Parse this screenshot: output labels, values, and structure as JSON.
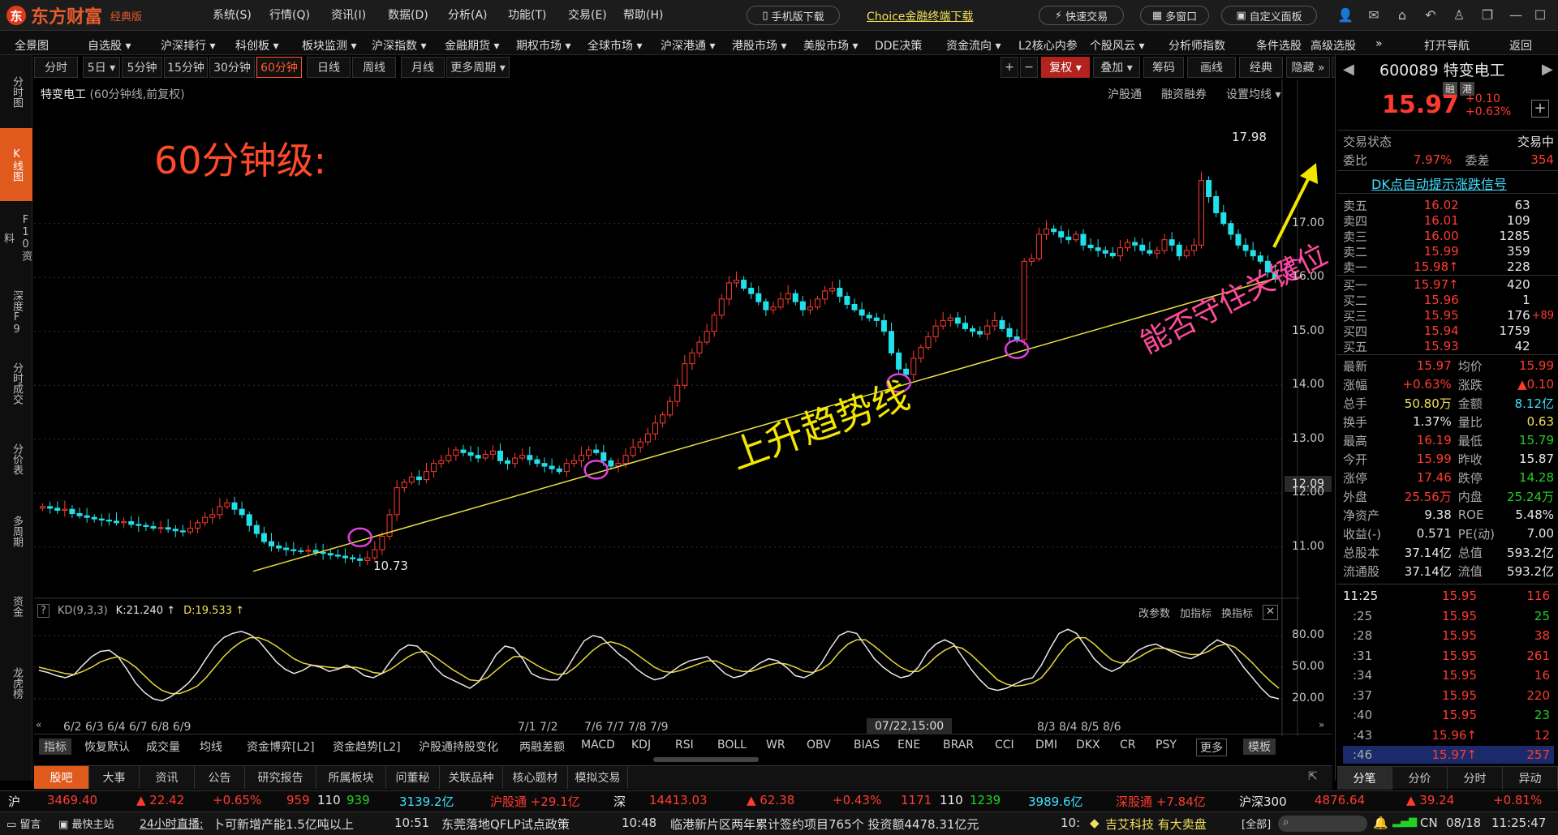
{
  "app": {
    "brand": "东方财富",
    "edition": "经典版"
  },
  "top_menu": [
    "系统(S)",
    "行情(Q)",
    "资讯(I)",
    "数据(D)",
    "分析(A)",
    "功能(T)",
    "交易(E)",
    "帮助(H)"
  ],
  "top_buttons": {
    "mobile": "手机版下载",
    "choice": "Choice金融终端下载",
    "quick_trade": "快速交易",
    "multi_window": "多窗口",
    "custom_panel": "自定义面板"
  },
  "nav_items": [
    "全景图",
    "自选股 ▾",
    "沪深排行 ▾",
    "科创板 ▾",
    "板块监测 ▾",
    "沪深指数 ▾",
    "金融期货 ▾",
    "期权市场 ▾",
    "全球市场 ▾",
    "沪深港通 ▾",
    "港股市场 ▾",
    "美股市场 ▾",
    "DDE决策",
    "资金流向 ▾",
    "L2核心内参",
    "个股风云 ▾",
    "分析师指数",
    "条件选股",
    "高级选股",
    "»",
    "打开导航",
    "返回"
  ],
  "left_tabs": [
    "分时图",
    "K线图",
    "F10资料",
    "深度F9",
    "分时成交",
    "分价表",
    "多周期",
    "资金",
    "龙虎榜"
  ],
  "period_tabs": [
    "分时",
    "5日 ▾",
    "5分钟",
    "15分钟",
    "30分钟",
    "60分钟",
    "日线",
    "周线",
    "月线",
    "更多周期 ▾"
  ],
  "active_period": "60分钟",
  "chart_tools": {
    "plus": "+",
    "minus": "−",
    "rights": "复权 ▾",
    "overlay": "叠加 ▾",
    "chips": "筹码",
    "draw": "画线",
    "classic": "经典",
    "hide": "隐藏 »"
  },
  "chart_header": {
    "name": "特变电工",
    "desc": "(60分钟线,前复权)",
    "links": [
      "沪股通",
      "融资融券",
      "设置均线 ▾"
    ]
  },
  "annotations": {
    "title": "60分钟级:",
    "trend": "上升趋势线",
    "key": "能否守住关键位",
    "high_label": "17.98",
    "low_label": "10.73",
    "crosshair_price": "12.09"
  },
  "colors": {
    "up": "#ff3b30",
    "down": "#22e0e8",
    "trendline": "#e8e23a",
    "k_line": "#e8e8e8",
    "d_line": "#e8d83a",
    "annotation_red": "#ff4a2a",
    "annotation_pink": "#ff4a9a",
    "annotation_yellow": "#f2e600",
    "circle": "#e040e0"
  },
  "y_ticks": [
    "17.00",
    "16.00",
    "15.00",
    "14.00",
    "13.00",
    "12.00",
    "11.00"
  ],
  "kd_header": {
    "help": "?",
    "name": "KD(9,3,3)",
    "k": "K:21.240 ↑",
    "d": "D:19.533 ↑",
    "links": [
      "改参数",
      "加指标",
      "换指标"
    ]
  },
  "kd_ticks": [
    "80.00",
    "50.00",
    "20.00"
  ],
  "x_labels": [
    "6/2 6/3 6/4 6/7 6/8 6/9",
    "7/1 7/2",
    "7/6 7/7 7/8 7/9",
    "07/22,15:00",
    "8/3 8/4 8/5 8/6"
  ],
  "chart_data": {
    "type": "candlestick",
    "title": "特变电工 (60分钟线,前复权)",
    "y_range": [
      10.5,
      18.5
    ],
    "annotated_high": 17.98,
    "annotated_low": 10.73,
    "trendline": {
      "from": {
        "x": "6/9",
        "y": 10.55
      },
      "to": {
        "x": "8/18",
        "y": 16.0
      }
    },
    "close_series": [
      11.75,
      11.72,
      11.68,
      11.7,
      11.62,
      11.58,
      11.55,
      11.52,
      11.5,
      11.48,
      11.45,
      11.47,
      11.42,
      11.4,
      11.38,
      11.35,
      11.36,
      11.33,
      11.3,
      11.28,
      11.35,
      11.45,
      11.55,
      11.6,
      11.75,
      11.82,
      11.7,
      11.6,
      11.4,
      11.25,
      11.1,
      11.02,
      10.98,
      10.95,
      10.93,
      10.92,
      10.94,
      10.9,
      10.88,
      10.85,
      10.83,
      10.8,
      10.78,
      10.75,
      10.8,
      10.95,
      11.2,
      11.6,
      12.1,
      12.2,
      12.3,
      12.25,
      12.4,
      12.55,
      12.6,
      12.7,
      12.8,
      12.75,
      12.7,
      12.65,
      12.72,
      12.78,
      12.6,
      12.55,
      12.65,
      12.7,
      12.62,
      12.55,
      12.5,
      12.45,
      12.4,
      12.55,
      12.6,
      12.7,
      12.8,
      12.75,
      12.6,
      12.5,
      12.55,
      12.7,
      12.85,
      12.95,
      13.1,
      13.3,
      13.45,
      13.7,
      14.0,
      14.4,
      14.6,
      14.8,
      15.0,
      15.3,
      15.6,
      15.9,
      15.95,
      15.8,
      15.7,
      15.55,
      15.4,
      15.45,
      15.6,
      15.7,
      15.55,
      15.4,
      15.45,
      15.6,
      15.75,
      15.8,
      15.65,
      15.5,
      15.4,
      15.3,
      15.25,
      15.2,
      15.0,
      14.6,
      14.3,
      14.2,
      14.5,
      14.7,
      14.9,
      15.1,
      15.2,
      15.25,
      15.15,
      15.05,
      15.0,
      14.95,
      15.1,
      15.2,
      15.05,
      14.9,
      14.85,
      16.3,
      16.35,
      16.8,
      16.9,
      16.85,
      16.75,
      16.7,
      16.8,
      16.6,
      16.55,
      16.5,
      16.45,
      16.4,
      16.55,
      16.65,
      16.6,
      16.5,
      16.45,
      16.5,
      16.7,
      16.6,
      16.4,
      16.5,
      16.6,
      17.8,
      17.5,
      17.2,
      17.0,
      16.8,
      16.6,
      16.5,
      16.4,
      16.3,
      16.1,
      15.97
    ]
  },
  "kd_data": {
    "k": [
      47,
      45,
      42,
      40,
      43,
      52,
      60,
      65,
      66,
      60,
      48,
      35,
      26,
      20,
      18,
      22,
      28,
      35,
      45,
      58,
      70,
      78,
      82,
      84,
      81,
      75,
      65,
      55,
      48,
      44,
      47,
      52,
      50,
      46,
      48,
      52,
      48,
      42,
      40,
      44,
      56,
      66,
      71,
      70,
      62,
      50,
      42,
      38,
      34,
      30,
      36,
      48,
      62,
      70,
      68,
      58,
      44,
      40,
      38,
      38,
      48,
      62,
      75,
      80,
      78,
      70,
      62,
      56,
      48,
      42,
      38,
      40,
      46,
      52,
      56,
      58,
      60,
      52,
      44,
      40,
      42,
      48,
      54,
      58,
      56,
      50,
      42,
      40,
      44,
      54,
      68,
      80,
      84,
      82,
      70,
      58,
      50,
      44,
      40,
      42,
      50,
      64,
      72,
      76,
      72,
      60,
      48,
      38,
      30,
      28,
      30,
      34,
      38,
      40,
      52,
      68,
      82,
      86,
      82,
      70,
      58,
      50,
      46,
      50,
      58,
      66,
      70,
      72,
      68,
      64,
      60,
      58,
      62,
      70,
      76,
      72,
      62,
      50,
      40,
      30,
      22,
      20
    ],
    "d": [
      50,
      48,
      46,
      44,
      43,
      46,
      50,
      55,
      58,
      60,
      56,
      50,
      42,
      34,
      28,
      25,
      25,
      28,
      32,
      40,
      50,
      60,
      68,
      74,
      78,
      78,
      75,
      70,
      64,
      58,
      54,
      52,
      51,
      50,
      49,
      50,
      50,
      48,
      45,
      44,
      48,
      54,
      60,
      64,
      65,
      60,
      54,
      48,
      43,
      38,
      37,
      40,
      47,
      54,
      60,
      60,
      55,
      50,
      46,
      43,
      44,
      50,
      58,
      66,
      72,
      74,
      72,
      68,
      62,
      56,
      50,
      46,
      45,
      47,
      50,
      53,
      56,
      56,
      52,
      48,
      46,
      46,
      49,
      52,
      54,
      53,
      50,
      46,
      45,
      48,
      54,
      64,
      72,
      76,
      76,
      70,
      63,
      56,
      50,
      46,
      46,
      52,
      60,
      66,
      70,
      68,
      62,
      54,
      46,
      38,
      34,
      32,
      33,
      35,
      40,
      50,
      62,
      72,
      78,
      78,
      72,
      64,
      57,
      54,
      55,
      59,
      64,
      68,
      68,
      66,
      64,
      62,
      62,
      65,
      70,
      72,
      69,
      62,
      54,
      45,
      37,
      30
    ]
  },
  "quote": {
    "code": "600089",
    "name": "特变电工",
    "tags": [
      "融",
      "港"
    ],
    "price": "15.97",
    "chg": "+0.10",
    "pct": "+0.63%",
    "status_label": "交易状态",
    "status": "交易中"
  },
  "ratio": {
    "wb_label": "委比",
    "wb": "7.97%",
    "wc_label": "委差",
    "wc": "354"
  },
  "dk_signal": "DK点自动提示涨跌信号",
  "asks": [
    {
      "label": "卖五",
      "price": "16.02",
      "vol": "63",
      "extra": ""
    },
    {
      "label": "卖四",
      "price": "16.01",
      "vol": "109",
      "extra": ""
    },
    {
      "label": "卖三",
      "price": "16.00",
      "vol": "1285",
      "extra": ""
    },
    {
      "label": "卖二",
      "price": "15.99",
      "vol": "359",
      "extra": ""
    },
    {
      "label": "卖一",
      "price": "15.98↑",
      "vol": "228",
      "extra": ""
    }
  ],
  "bids": [
    {
      "label": "买一",
      "price": "15.97↑",
      "vol": "420",
      "extra": ""
    },
    {
      "label": "买二",
      "price": "15.96",
      "vol": "1",
      "extra": ""
    },
    {
      "label": "买三",
      "price": "15.95",
      "vol": "176",
      "extra": "+89"
    },
    {
      "label": "买四",
      "price": "15.94",
      "vol": "1759",
      "extra": ""
    },
    {
      "label": "买五",
      "price": "15.93",
      "vol": "42",
      "extra": ""
    }
  ],
  "stats": [
    {
      "l1": "最新",
      "v1": "15.97",
      "c1": "red",
      "l2": "均价",
      "v2": "15.99",
      "c2": "red"
    },
    {
      "l1": "涨幅",
      "v1": "+0.63%",
      "c1": "red",
      "l2": "涨跌",
      "v2": "▲0.10",
      "c2": "red"
    },
    {
      "l1": "总手",
      "v1": "50.80万",
      "c1": "yel",
      "l2": "金额",
      "v2": "8.12亿",
      "c2": "cyn"
    },
    {
      "l1": "换手",
      "v1": "1.37%",
      "c1": "wht",
      "l2": "量比",
      "v2": "0.63",
      "c2": "yel"
    },
    {
      "l1": "最高",
      "v1": "16.19",
      "c1": "red",
      "l2": "最低",
      "v2": "15.79",
      "c2": "grn"
    },
    {
      "l1": "今开",
      "v1": "15.99",
      "c1": "red",
      "l2": "昨收",
      "v2": "15.87",
      "c2": "wht"
    },
    {
      "l1": "涨停",
      "v1": "17.46",
      "c1": "red",
      "l2": "跌停",
      "v2": "14.28",
      "c2": "grn"
    },
    {
      "l1": "外盘",
      "v1": "25.56万",
      "c1": "red",
      "l2": "内盘",
      "v2": "25.24万",
      "c2": "grn"
    },
    {
      "l1": "净资产",
      "v1": "9.38",
      "c1": "wht",
      "l2": "ROE",
      "v2": "5.48%",
      "c2": "wht"
    },
    {
      "l1": "收益(-)",
      "v1": "0.571",
      "c1": "wht",
      "l2": "PE(动)",
      "v2": "7.00",
      "c2": "wht"
    },
    {
      "l1": "总股本",
      "v1": "37.14亿",
      "c1": "wht",
      "l2": "总值",
      "v2": "593.2亿",
      "c2": "wht"
    },
    {
      "l1": "流通股",
      "v1": "37.14亿",
      "c1": "wht",
      "l2": "流值",
      "v2": "593.2亿",
      "c2": "wht"
    }
  ],
  "ticks": [
    {
      "t": "11:25",
      "p": "15.95",
      "v": "116",
      "vc": "red"
    },
    {
      "t": ":25",
      "p": "15.95",
      "v": "25",
      "vc": "grn"
    },
    {
      "t": ":28",
      "p": "15.95",
      "v": "38",
      "vc": "red"
    },
    {
      "t": ":31",
      "p": "15.95",
      "v": "261",
      "vc": "red"
    },
    {
      "t": ":34",
      "p": "15.95",
      "v": "16",
      "vc": "red"
    },
    {
      "t": ":37",
      "p": "15.95",
      "v": "220",
      "vc": "red"
    },
    {
      "t": ":40",
      "p": "15.95",
      "v": "23",
      "vc": "grn"
    },
    {
      "t": ":43",
      "p": "15.96↑",
      "v": "12",
      "vc": "red"
    },
    {
      "t": ":46",
      "p": "15.97↑",
      "v": "257",
      "vc": "red"
    }
  ],
  "rtabs": [
    "分笔",
    "分价",
    "分时",
    "异动"
  ],
  "indicator_tabs": [
    "指标",
    "恢复默认",
    "成交量",
    "均线",
    "资金博弈[L2]",
    "资金趋势[L2]",
    "沪股通持股变化",
    "两融差额",
    "MACD",
    "KDJ",
    "RSI",
    "BOLL",
    "WR",
    "OBV",
    "BIAS",
    "ENE",
    "BRAR",
    "CCI",
    "DMI",
    "DKX",
    "CR",
    "PSY",
    "更多",
    "模板"
  ],
  "bottom_tabs": [
    "股吧",
    "大事",
    "资讯",
    "公告",
    "研究报告",
    "所属板块",
    "问董秘",
    "关联品种",
    "核心题材",
    "模拟交易"
  ],
  "index_bar": {
    "sh_label": "沪",
    "sh": "3469.40",
    "sh_chg": "▲ 22.42",
    "sh_pct": "+0.65%",
    "sh_up": "959",
    "sh_flat": "110",
    "sh_dn": "939",
    "sh_amt": "3139.2亿",
    "hgt": "沪股通 +29.1亿",
    "sz_label": "深",
    "sz": "14413.03",
    "sz_chg": "▲ 62.38",
    "sz_pct": "+0.43%",
    "sz_up": "1171",
    "sz_flat": "110",
    "sz_dn": "1239",
    "sz_amt": "3989.6亿",
    "sgt": "深股通 +7.84亿",
    "hs300_label": "沪深300",
    "hs300": "4876.64",
    "hs300_chg": "▲ 39.24",
    "hs300_pct": "+0.81%"
  },
  "news_bar": {
    "msg": "留言",
    "hk": "最快主站",
    "live": "24小时直播:",
    "n1": "卜可新增产能1.5亿吨以上",
    "t2": "10:51",
    "n2": "东莞落地QFLP试点政策",
    "t3": "10:48",
    "n3": "临港新片区两年累计签约项目765个 投资额4478.31亿元",
    "t4": "10:",
    "n4": "吉艾科技 有大卖盘",
    "all": "[全部]",
    "region": "CN",
    "date": "08/18",
    "time": "11:25:47"
  }
}
